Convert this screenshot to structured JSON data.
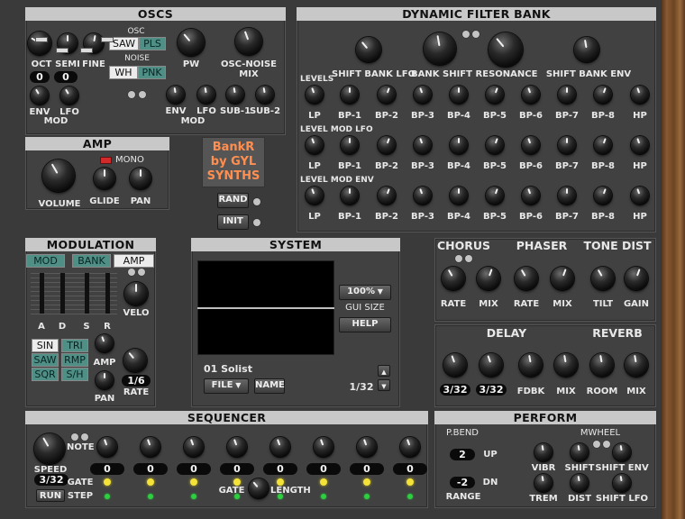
{
  "oscs": {
    "title": "OSCS",
    "knobs": [
      "OCT",
      "SEMI",
      "FINE",
      "PW"
    ],
    "osc_noise_mix": "OSC-NOISE MIX",
    "osc_label": "OSC",
    "noise_label": "NOISE",
    "oct_value": "0",
    "semi_value": "0",
    "wave": {
      "saw": "SAW",
      "pls": "PLS",
      "wh": "WH",
      "pnk": "PNK"
    },
    "mod_knobs_left": [
      "ENV",
      "LFO"
    ],
    "mod_knobs_right": [
      "ENV",
      "LFO",
      "SUB-1",
      "SUB-2"
    ],
    "mod_label": "MOD"
  },
  "amp": {
    "title": "AMP",
    "mono": "MONO",
    "knobs": [
      "VOLUME",
      "GLIDE",
      "PAN"
    ]
  },
  "logo": {
    "line1": "BankR",
    "line2": "by GYL",
    "line3": "SYNTHS"
  },
  "buttons": {
    "rand": "RAND",
    "init": "INIT"
  },
  "filter": {
    "title": "DYNAMIC FILTER BANK",
    "top_knobs": [
      "SHIFT BANK LFO",
      "BANK SHIFT",
      "RESONANCE",
      "SHIFT BANK ENV"
    ],
    "rows": [
      "LEVELS",
      "LEVEL MOD LFO",
      "LEVEL MOD ENV"
    ],
    "bands": [
      "LP",
      "BP-1",
      "BP-2",
      "BP-3",
      "BP-4",
      "BP-5",
      "BP-6",
      "BP-7",
      "BP-8",
      "HP"
    ]
  },
  "modulation": {
    "title": "MODULATION",
    "tabs": [
      "MOD",
      "BANK",
      "AMP"
    ],
    "adsr": [
      "A",
      "D",
      "S",
      "R"
    ],
    "velo": "VELO",
    "lfo_waves": [
      "SIN",
      "TRI",
      "SAW",
      "RMP",
      "SQR",
      "S/H"
    ],
    "amp": "AMP",
    "pan": "PAN",
    "rate": "RATE",
    "rate_value": "1/6"
  },
  "system": {
    "title": "SYSTEM",
    "gui_size_value": "100%",
    "gui_size_label": "GUI SIZE",
    "help": "HELP",
    "preset_name": "01 Solist",
    "file": "FILE",
    "name": "NAME",
    "page": "1/32"
  },
  "fx_top": {
    "headers": [
      "CHORUS",
      "PHASER",
      "TONE DIST"
    ],
    "knobs": [
      "RATE",
      "MIX",
      "RATE",
      "MIX",
      "TILT",
      "GAIN"
    ]
  },
  "fx_bottom": {
    "headers": [
      "DELAY",
      "REVERB"
    ],
    "delay_values": [
      "3/32",
      "3/32"
    ],
    "knobs": [
      "FDBK",
      "MIX",
      "ROOM",
      "MIX"
    ]
  },
  "sequencer": {
    "title": "SEQUENCER",
    "note": "NOTE",
    "speed": "SPEED",
    "speed_value": "3/32",
    "gate": "GATE",
    "step": "STEP",
    "run": "RUN",
    "note_values": [
      "0",
      "0",
      "0",
      "0",
      "0",
      "0",
      "0",
      "0"
    ],
    "gate_length": [
      "GATE",
      "LENGTH"
    ]
  },
  "perform": {
    "title": "PERFORM",
    "pbend": "P.BEND",
    "up_value": "2",
    "up": "UP",
    "dn_value": "-2",
    "dn": "DN",
    "range": "RANGE",
    "mwheel": "MWHEEL",
    "knobs": [
      "VIBR",
      "SHIFT",
      "SHIFT ENV",
      "TREM",
      "DIST",
      "SHIFT LFO"
    ]
  },
  "colors": {
    "teal": "#4f8f86",
    "orange": "#ff8f50",
    "header": "#c8c8c8",
    "panel": "#414141"
  }
}
